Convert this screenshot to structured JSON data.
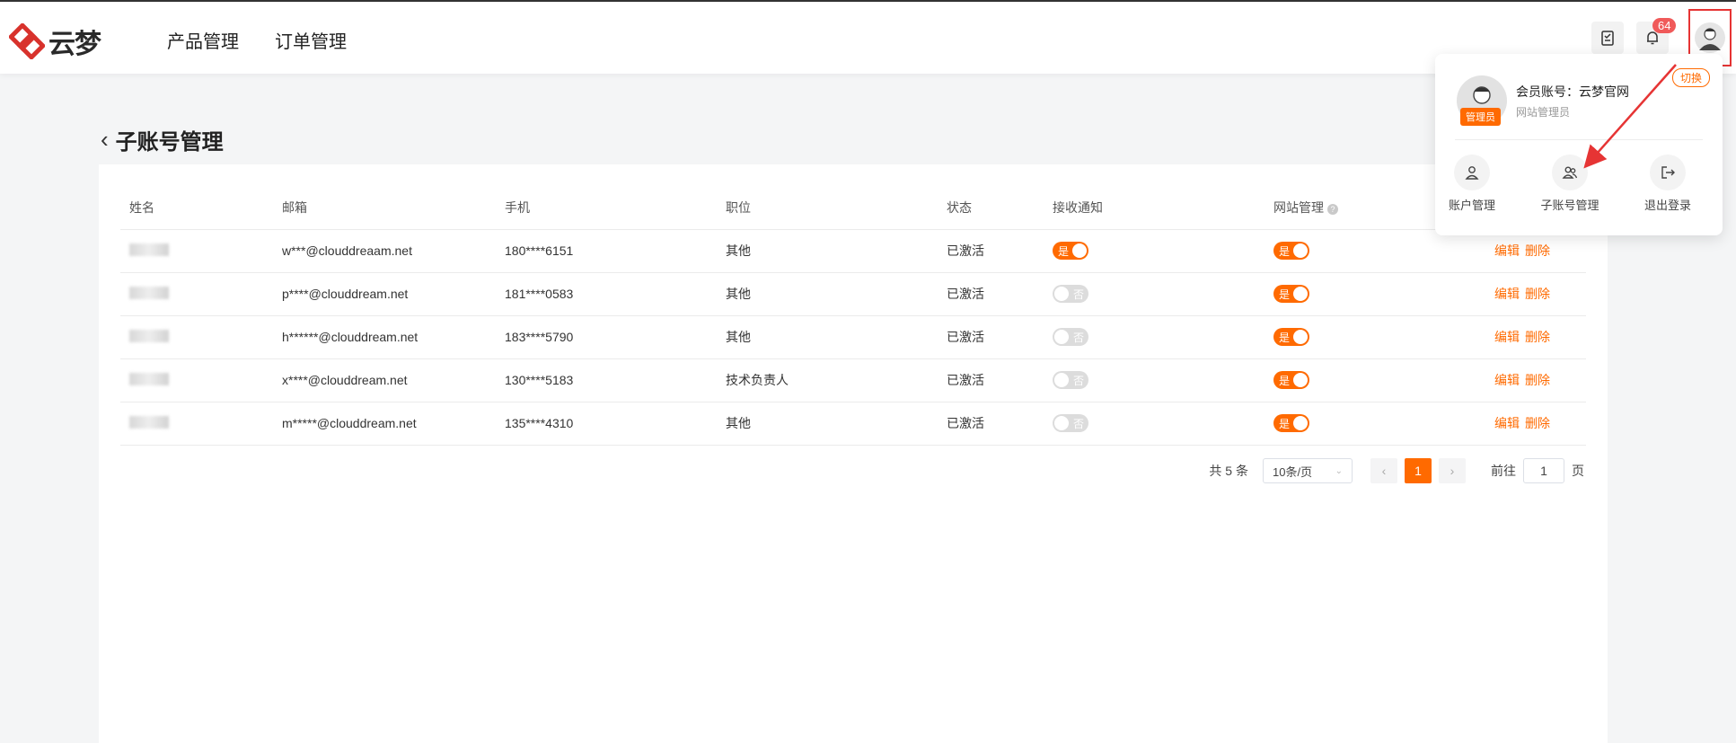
{
  "header": {
    "logo_text": "云梦",
    "nav": [
      "产品管理",
      "订单管理"
    ],
    "notification_count": "64"
  },
  "page": {
    "title": "子账号管理"
  },
  "table": {
    "columns": [
      "姓名",
      "邮箱",
      "手机",
      "职位",
      "状态",
      "接收通知",
      "网站管理",
      ""
    ],
    "rows": [
      {
        "email": "w***@clouddreaam.net",
        "phone": "180****6151",
        "position": "其他",
        "status": "已激活",
        "notify": "是",
        "site": "是"
      },
      {
        "email": "p****@clouddream.net",
        "phone": "181****0583",
        "position": "其他",
        "status": "已激活",
        "notify": "否",
        "site": "是"
      },
      {
        "email": "h******@clouddream.net",
        "phone": "183****5790",
        "position": "其他",
        "status": "已激活",
        "notify": "否",
        "site": "是"
      },
      {
        "email": "x****@clouddream.net",
        "phone": "130****5183",
        "position": "技术负责人",
        "status": "已激活",
        "notify": "否",
        "site": "是"
      },
      {
        "email": "m*****@clouddream.net",
        "phone": "135****4310",
        "position": "其他",
        "status": "已激活",
        "notify": "否",
        "site": "是"
      }
    ],
    "action_edit": "编辑",
    "action_delete": "删除"
  },
  "pagination": {
    "total": "共 5 条",
    "page_size": "10条/页",
    "current": "1",
    "goto_prefix": "前往",
    "goto_value": "1",
    "goto_suffix": "页"
  },
  "dropdown": {
    "account_label": "会员账号：云梦官网",
    "role": "网站管理员",
    "admin_tag": "管理员",
    "switch_label": "切换",
    "items": [
      "账户管理",
      "子账号管理",
      "退出登录"
    ]
  },
  "colors": {
    "accent": "#ff6a00",
    "annotation": "#e63434",
    "badge": "#f05a5a"
  }
}
